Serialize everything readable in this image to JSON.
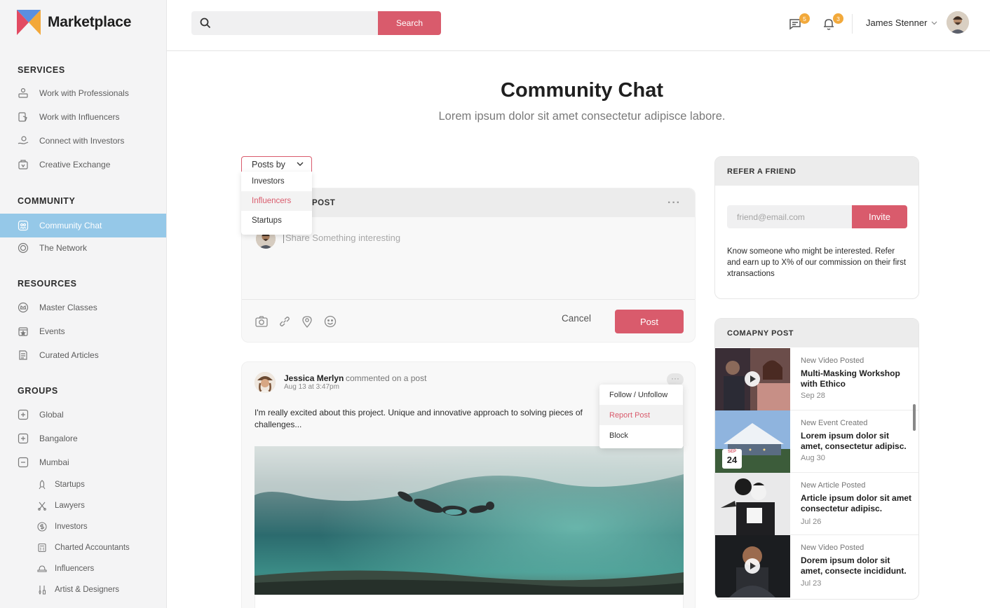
{
  "app": {
    "name": "Marketplace"
  },
  "colors": {
    "accent": "#d95b6c",
    "active_nav": "#95c8e8",
    "badge": "#f2a93b"
  },
  "sidebar": {
    "sections": [
      {
        "title": "SERVICES"
      },
      {
        "title": "COMMUNITY"
      },
      {
        "title": "RESOURCES"
      },
      {
        "title": "GROUPS"
      }
    ],
    "services": [
      {
        "label": "Work with Professionals",
        "icon": "professional-icon"
      },
      {
        "label": "Work with Influencers",
        "icon": "influencer-icon"
      },
      {
        "label": "Connect with Investors",
        "icon": "investor-icon"
      },
      {
        "label": "Creative Exchange",
        "icon": "creative-exchange-icon"
      }
    ],
    "community": [
      {
        "label": "Community Chat",
        "icon": "chat-icon",
        "active": true
      },
      {
        "label": "The Network",
        "icon": "network-icon"
      }
    ],
    "resources": [
      {
        "label": "Master Classes",
        "icon": "crown-icon"
      },
      {
        "label": "Events",
        "icon": "calendar-icon"
      },
      {
        "label": "Curated Articles",
        "icon": "article-icon"
      }
    ],
    "groups": [
      {
        "label": "Global",
        "icon": "plus-box-icon"
      },
      {
        "label": "Bangalore",
        "icon": "plus-box-icon"
      },
      {
        "label": "Mumbai",
        "icon": "minus-box-icon"
      }
    ],
    "subgroups": [
      {
        "label": "Startups",
        "icon": "rocket-icon"
      },
      {
        "label": "Lawyers",
        "icon": "scales-icon"
      },
      {
        "label": "Investors",
        "icon": "dollar-icon"
      },
      {
        "label": "Charted Accountants",
        "icon": "calculator-icon"
      },
      {
        "label": "Influencers",
        "icon": "hat-icon"
      },
      {
        "label": "Artist & Designers",
        "icon": "brush-icon"
      }
    ]
  },
  "header": {
    "search_placeholder": "",
    "search_button": "Search",
    "messages_count": "5",
    "notifications_count": "3",
    "user_name": "James Stenner"
  },
  "main": {
    "title": "Community Chat",
    "subtitle": "Lorem ipsum dolor sit amet consectetur adipisce labore."
  },
  "posts_filter": {
    "label": "Posts by",
    "options": [
      "Investors",
      "Influencers",
      "Startups"
    ],
    "selected": "Influencers"
  },
  "composer": {
    "header_suffix": "POST",
    "placeholder": "Share Something interesting",
    "cancel": "Cancel",
    "post": "Post"
  },
  "feed_post": {
    "author": "Jessica Merlyn",
    "action": "commented on a post",
    "time": "Aug 13 at 3:47pm",
    "text": "I'm really excited about this project. Unique and innovative approach to solving pieces of challenges...",
    "menu": [
      "Follow / Unfollow",
      "Report Post",
      "Block"
    ],
    "menu_highlight": "Report Post"
  },
  "refer": {
    "title": "REFER A FRIEND",
    "placeholder": "friend@email.com",
    "button": "Invite",
    "text": "Know someone who might be interested. Refer and earn up to X%  of our commission on their first xtransactions"
  },
  "company_post": {
    "title": "COMAPNY POST",
    "items": [
      {
        "kind": "New Video Posted",
        "title": "Multi-Masking Workshop with Ethico",
        "date": "Sep 28"
      },
      {
        "kind": "New Event Created",
        "title": "Lorem ipsum dolor sit amet, consectetur adipisc.",
        "date": "Aug 30",
        "cal_month": "SEP",
        "cal_day": "24"
      },
      {
        "kind": "New Article Posted",
        "title": "Article ipsum dolor sit amet consectetur adipisc.",
        "date": "Jul 26"
      },
      {
        "kind": "New Video Posted",
        "title": "Dorem ipsum dolor sit amet, consecte incididunt.",
        "date": "Jul 23"
      }
    ]
  }
}
